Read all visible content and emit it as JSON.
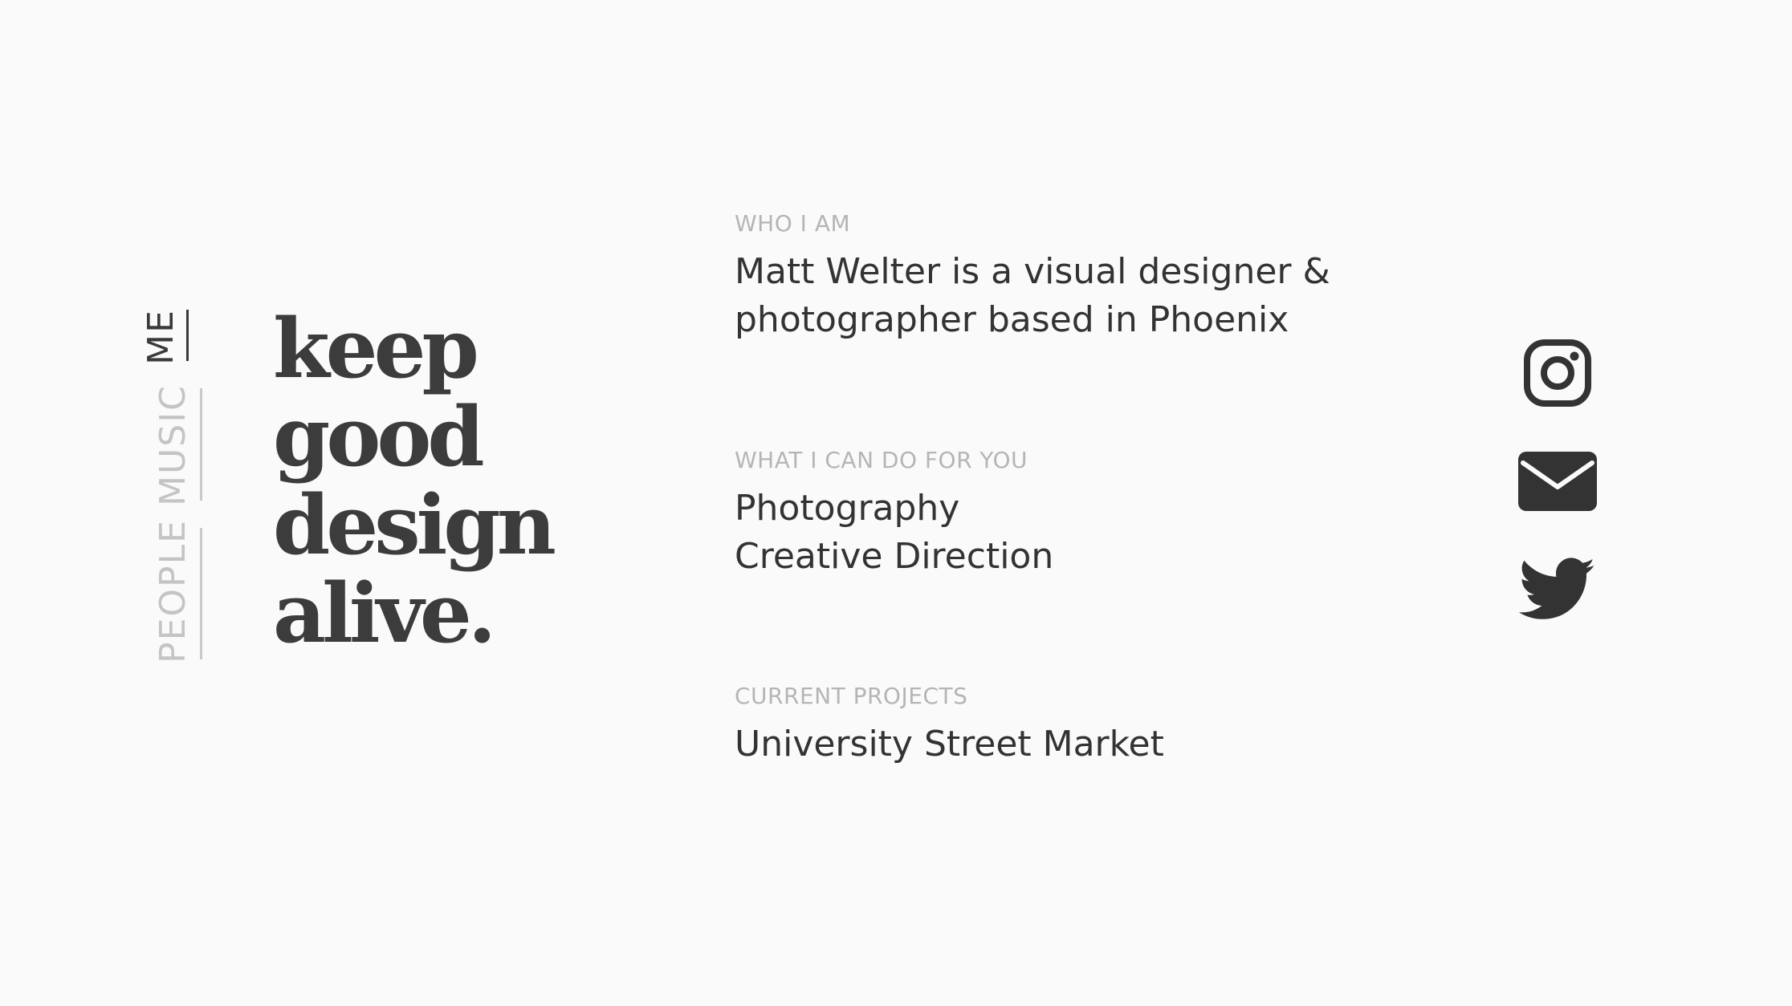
{
  "nav": {
    "items": [
      {
        "label": "ME",
        "active": true
      },
      {
        "label": "MUSIC",
        "active": false
      },
      {
        "label": "PEOPLE",
        "active": false
      }
    ]
  },
  "tagline": {
    "lines": [
      "keep",
      "good",
      "design",
      "alive."
    ]
  },
  "sections": {
    "who": {
      "label": "WHO I AM",
      "lines": [
        "Matt Welter is a visual designer &",
        "photographer based in Phoenix"
      ]
    },
    "what": {
      "label": "WHAT I CAN DO FOR YOU",
      "lines": [
        "Photography",
        "Creative Direction"
      ]
    },
    "projects": {
      "label": "CURRENT PROJECTS",
      "lines": [
        "University Street Market"
      ]
    }
  },
  "social": {
    "icons": [
      "instagram-icon",
      "email-icon",
      "twitter-icon"
    ]
  },
  "colors": {
    "background": "#fafafa",
    "text_dark": "#333333",
    "text_muted": "#b5b5b5",
    "nav_inactive": "#c4c4c4"
  }
}
